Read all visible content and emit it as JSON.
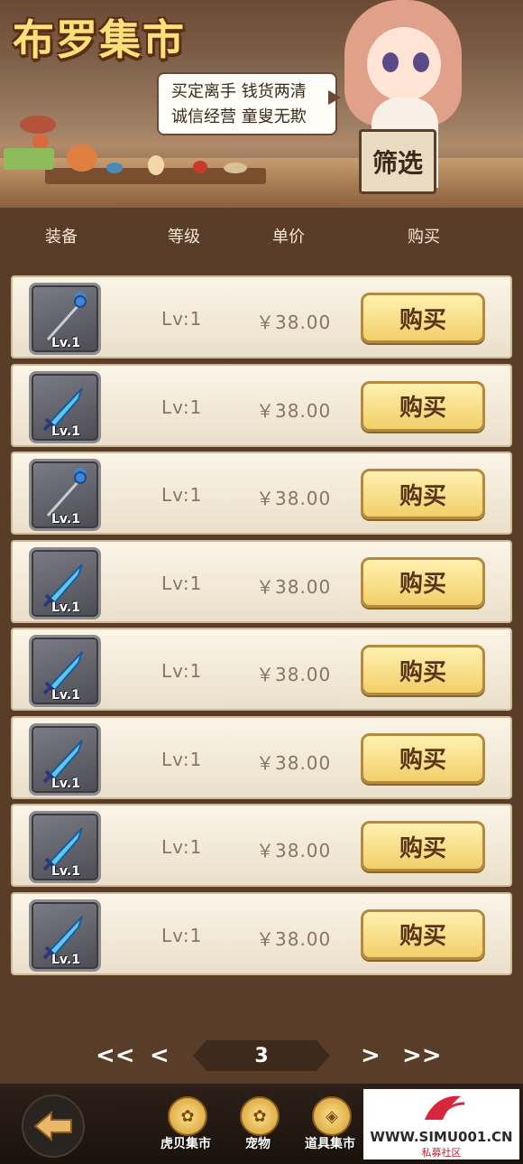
{
  "banner": {
    "title": "布罗集市",
    "speech_line1": "买定离手 钱货两清",
    "speech_line2": "诚信经营 童叟无欺",
    "filter_label": "筛选"
  },
  "columns": {
    "equip": "装备",
    "level": "等级",
    "price": "单价",
    "buy": "购买"
  },
  "items": [
    {
      "icon": "staff-icon",
      "tag": "Lv.1",
      "level": "Lv:1",
      "price": "￥38.00",
      "buy": "购买"
    },
    {
      "icon": "sword-icon",
      "tag": "Lv.1",
      "level": "Lv:1",
      "price": "￥38.00",
      "buy": "购买"
    },
    {
      "icon": "staff-icon",
      "tag": "Lv.1",
      "level": "Lv:1",
      "price": "￥38.00",
      "buy": "购买"
    },
    {
      "icon": "sword-icon",
      "tag": "Lv.1",
      "level": "Lv:1",
      "price": "￥38.00",
      "buy": "购买"
    },
    {
      "icon": "sword-icon",
      "tag": "Lv.1",
      "level": "Lv:1",
      "price": "￥38.00",
      "buy": "购买"
    },
    {
      "icon": "sword-icon",
      "tag": "Lv.1",
      "level": "Lv:1",
      "price": "￥38.00",
      "buy": "购买"
    },
    {
      "icon": "sword-icon",
      "tag": "Lv.1",
      "level": "Lv:1",
      "price": "￥38.00",
      "buy": "购买"
    },
    {
      "icon": "sword-icon",
      "tag": "Lv.1",
      "level": "Lv:1",
      "price": "￥38.00",
      "buy": "购买"
    }
  ],
  "pager": {
    "first": "<<",
    "prev": "<",
    "current": "3",
    "next": ">",
    "last": ">>"
  },
  "bottom_nav": {
    "back_icon": "back-arrow-icon",
    "items": [
      {
        "label": "虎贝集市",
        "icon": "paw-medal-icon"
      },
      {
        "label": "宠物",
        "icon": "paw-medal-icon"
      },
      {
        "label": "道具集市",
        "icon": "bag-medal-icon"
      }
    ]
  },
  "watermark": {
    "url": "WWW.SIMU001.CN",
    "sub": "私募社区"
  },
  "colors": {
    "background": "#5a3d28",
    "row": "#f5ecdb",
    "buy_button": "#f2cf6a",
    "title": "#ffe07a"
  }
}
